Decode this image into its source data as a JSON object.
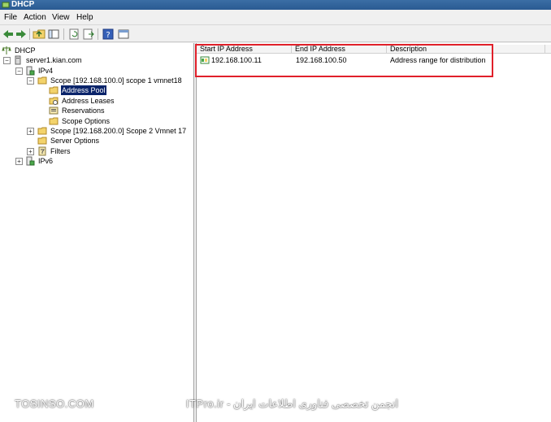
{
  "window": {
    "title": "DHCP"
  },
  "menu": [
    "File",
    "Action",
    "View",
    "Help"
  ],
  "toolbar": [
    "back-icon",
    "forward-icon",
    "up-folder-icon",
    "show-hide-tree-icon",
    "refresh-icon",
    "export-icon",
    "help-icon",
    "properties-icon"
  ],
  "tree": {
    "root": "DHCP",
    "server": "server1.kian.com",
    "ipv4": "IPv4",
    "scope1": "Scope [192.168.100.0] scope 1 vmnet18",
    "address_pool": "Address Pool",
    "address_leases": "Address Leases",
    "reservations": "Reservations",
    "scope_options": "Scope Options",
    "scope2": "Scope [192.168.200.0] Scope 2 Vmnet 17",
    "server_options": "Server Options",
    "filters": "Filters",
    "ipv6": "IPv6"
  },
  "list": {
    "columns": [
      "Start IP Address",
      "End IP Address",
      "Description"
    ],
    "rows": [
      {
        "start": "192.168.100.11",
        "end": "192.168.100.50",
        "description": "Address range for distribution"
      }
    ]
  },
  "watermark": {
    "left": "TOSINSO.COM",
    "right": "انجمن تخصصی فناوری اطلاعات ایران - ITPro.ir"
  },
  "colors": {
    "highlight": "#e0202a",
    "selection": "#0a246a",
    "titlebar": "#3b6ea5"
  }
}
